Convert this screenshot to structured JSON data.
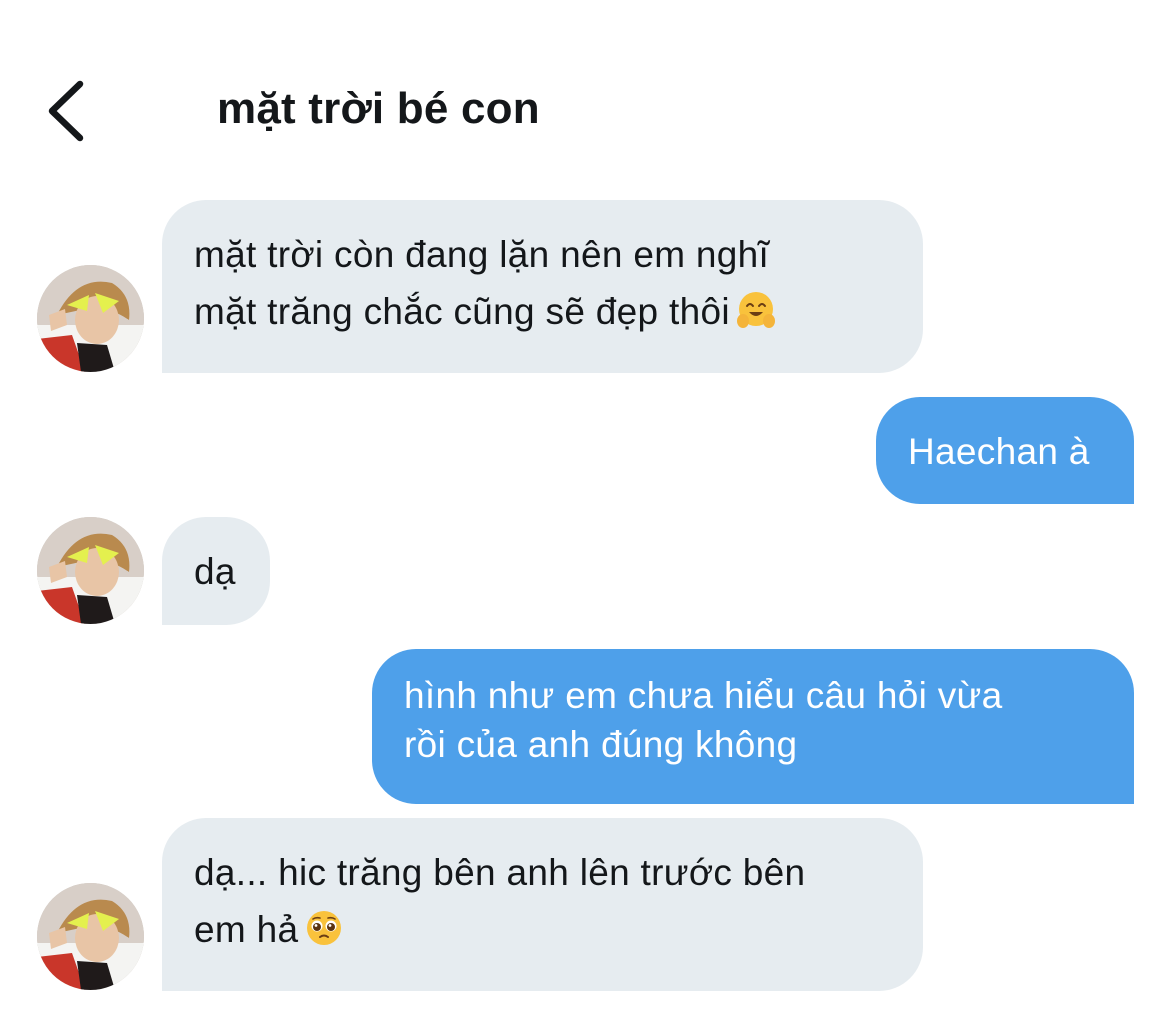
{
  "header": {
    "back_icon": "chevron-left-icon",
    "title": "mặt trời bé con"
  },
  "colors": {
    "sent_bubble": "#4ea0ea",
    "received_bubble": "#e6ecf0",
    "text_dark": "#14171a"
  },
  "messages": [
    {
      "direction": "received",
      "text": "mặt trời còn đang lặn nên em nghĩ mặt trăng chắc cũng sẽ đẹp thôi",
      "line1": "mặt trời còn đang lặn nên em nghĩ",
      "line2": "mặt trăng chắc cũng sẽ đẹp thôi",
      "emoji": "hugging-face-emoji"
    },
    {
      "direction": "sent",
      "text": "Haechan à"
    },
    {
      "direction": "received",
      "text": "dạ"
    },
    {
      "direction": "sent",
      "text": "hình như em chưa hiểu câu hỏi vừa rồi của anh đúng không",
      "line1": "hình như em chưa hiểu câu hỏi vừa",
      "line2": "rồi của anh đúng không"
    },
    {
      "direction": "received",
      "text": "dạ... hic trăng bên anh lên trước bên em hả",
      "line1": "dạ... hic trăng bên anh lên trước bên",
      "line2": "em hả",
      "emoji": "pleading-face-emoji"
    }
  ]
}
